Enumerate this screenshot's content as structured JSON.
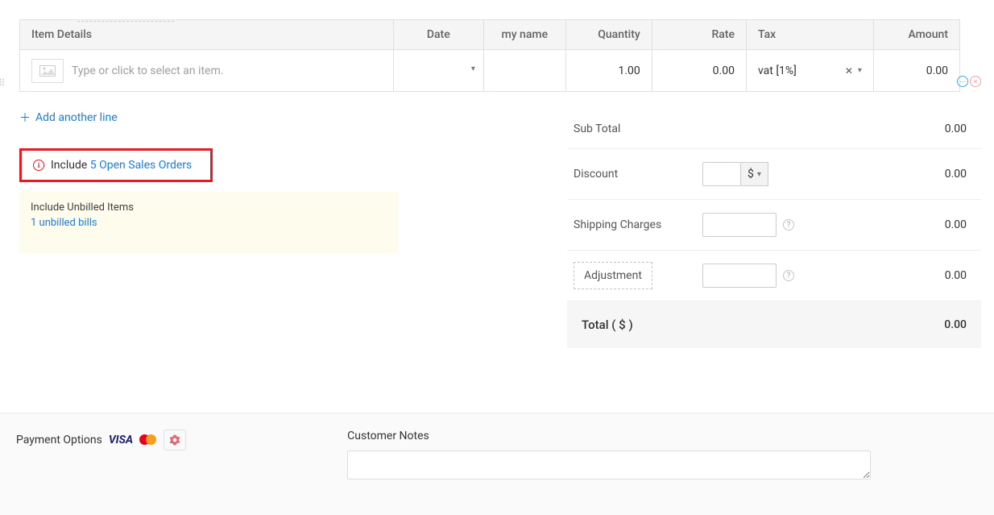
{
  "table": {
    "headers": {
      "item": "Item Details",
      "date": "Date",
      "name": "my name",
      "qty": "Quantity",
      "rate": "Rate",
      "tax": "Tax",
      "amount": "Amount"
    },
    "row": {
      "placeholder": "Type or click to select an item.",
      "qty": "1.00",
      "rate": "0.00",
      "tax": "vat [1%]",
      "amount": "0.00"
    }
  },
  "actions": {
    "add_line": "Add another line",
    "include_prefix": "Include",
    "include_link": "5 Open Sales Orders",
    "unbilled_title": "Include Unbilled Items",
    "unbilled_link": "1 unbilled bills"
  },
  "totals": {
    "subtotal_label": "Sub Total",
    "subtotal": "0.00",
    "discount_label": "Discount",
    "discount_currency": "$",
    "discount": "0.00",
    "shipping_label": "Shipping Charges",
    "shipping": "0.00",
    "adjustment_label": "Adjustment",
    "adjustment": "0.00",
    "total_label": "Total ( $ )",
    "total": "0.00"
  },
  "footer": {
    "payment_label": "Payment Options",
    "visa": "VISA",
    "notes_label": "Customer Notes"
  }
}
